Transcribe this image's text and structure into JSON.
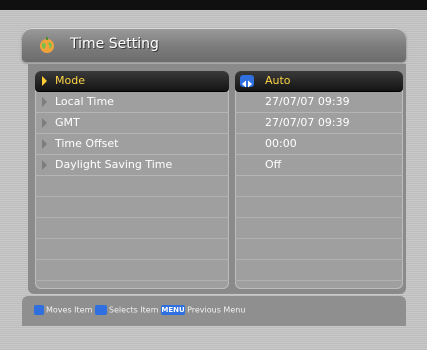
{
  "header": {
    "title": "Time Setting",
    "icon": "globe-icon"
  },
  "rows": [
    {
      "label": "Mode",
      "value": "Auto",
      "selected": true
    },
    {
      "label": "Local Time",
      "value": "27/07/07 09:39"
    },
    {
      "label": "GMT",
      "value": "27/07/07 09:39"
    },
    {
      "label": "Time Offset",
      "value": "00:00"
    },
    {
      "label": "Daylight Saving Time",
      "value": "Off"
    }
  ],
  "help": {
    "moves": "Moves Item",
    "selects": "Selects Item",
    "menu_key": "MENU",
    "previous": "Previous Menu"
  },
  "colors": {
    "accent": "#ffcc33",
    "key_blue": "#2f6fe0"
  }
}
